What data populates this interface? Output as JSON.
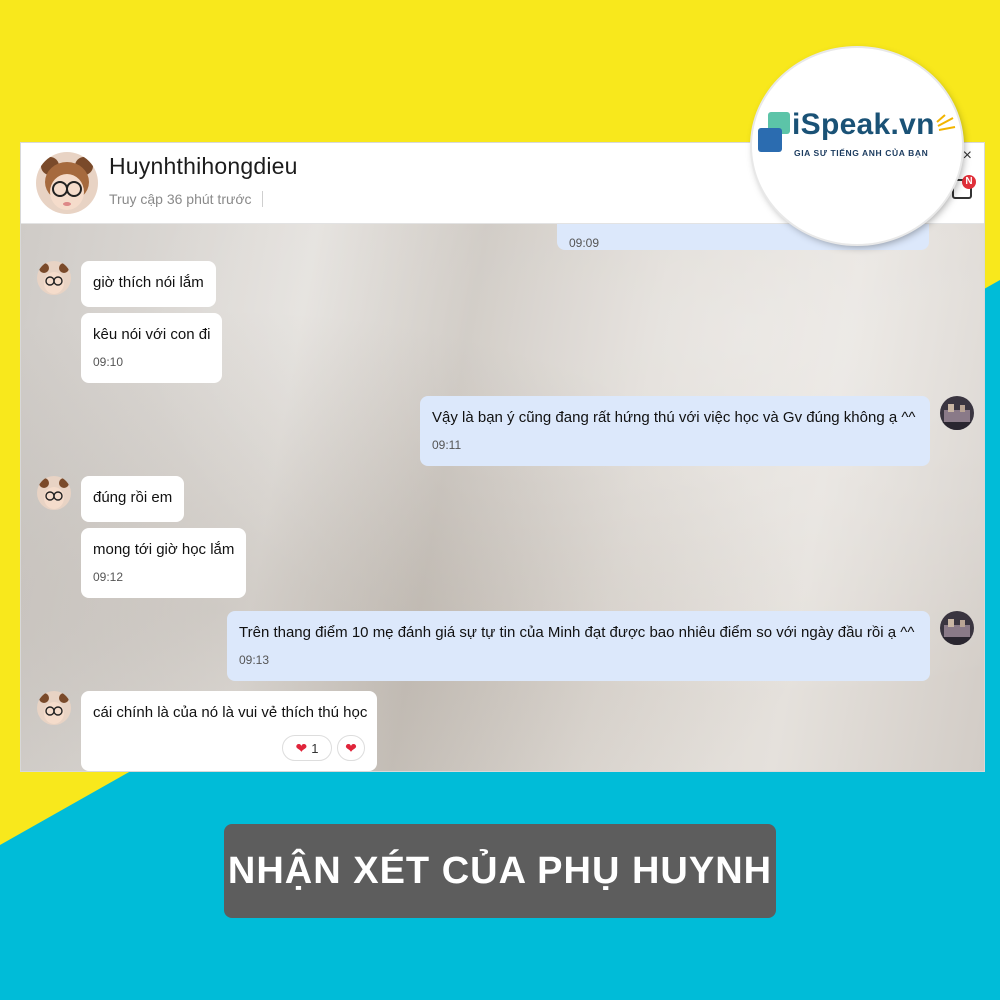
{
  "header": {
    "name": "Huynhthihongdieu",
    "status": "Truy cập 36 phút trước",
    "close": "×",
    "badge": "N"
  },
  "logo": {
    "name": "iSpeak.vn",
    "tagline": "GIA SƯ TIẾNG ANH CỦA BẠN"
  },
  "messages": [
    {
      "side": "out",
      "text": "",
      "time": "09:09"
    },
    {
      "side": "in",
      "text": "giờ thích nói lắm",
      "time": ""
    },
    {
      "side": "in",
      "text": "kêu nói với con đi",
      "time": "09:10"
    },
    {
      "side": "out",
      "text": "Vậy là bạn ý cũng đang rất hứng thú với việc học và Gv đúng không ạ ^^",
      "time": "09:11"
    },
    {
      "side": "in",
      "text": "đúng rồi em",
      "time": ""
    },
    {
      "side": "in",
      "text": "mong tới giờ học lắm",
      "time": "09:12"
    },
    {
      "side": "out",
      "text": "Trên thang điểm 10 mẹ đánh giá sự tự tin của Minh đạt được bao nhiêu điểm so với ngày đầu rồi ạ ^^",
      "time": "09:13"
    },
    {
      "side": "in",
      "text": "cái chính là của nó là vui vẻ thích thú học",
      "time": ""
    }
  ],
  "reaction": {
    "icon": "heart-icon",
    "count": "1"
  },
  "banner": {
    "title": "NHẬN XÉT CỦA PHỤ HUYNH"
  },
  "colors": {
    "yellow": "#f8e81c",
    "cyan": "#00bcd8",
    "outgoing": "#dce8fb",
    "banner": "#5d5d5d"
  }
}
